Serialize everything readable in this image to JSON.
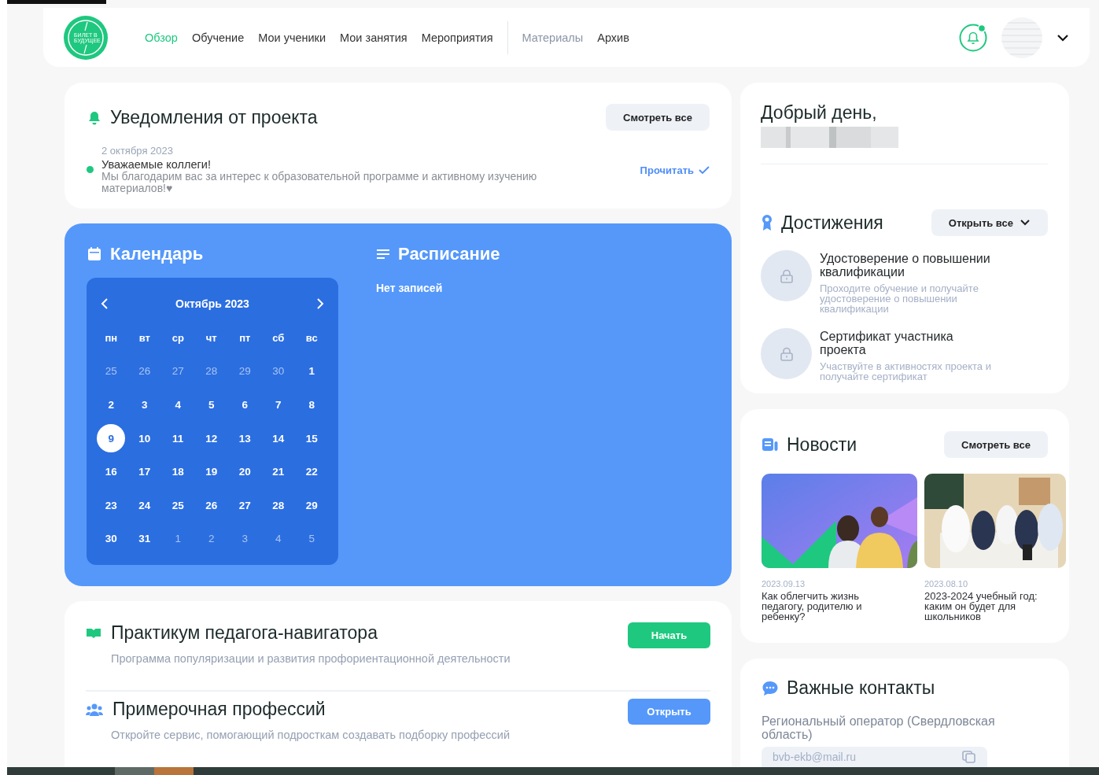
{
  "nav": {
    "logo_text": "БИЛЕТ В БУДУЩЕЕ",
    "item_groups": [
      [
        {
          "label": "Обзор",
          "selected": true,
          "disabled": false
        },
        {
          "label": "Обучение",
          "selected": false,
          "disabled": false
        },
        {
          "label": "Мои ученики",
          "selected": false,
          "disabled": false
        },
        {
          "label": "Мои занятия",
          "selected": false,
          "disabled": false
        },
        {
          "label": "Мероприятия",
          "selected": false,
          "disabled": false
        }
      ],
      [
        {
          "label": "Материалы",
          "selected": false,
          "disabled": true
        },
        {
          "label": "Архив",
          "selected": false,
          "disabled": false
        }
      ]
    ],
    "has_unread": true
  },
  "notifications": {
    "title": "Уведомления от проекта",
    "button": "Смотреть все",
    "items": [
      {
        "date": "2 октября 2023",
        "title": "Уважаемые коллеги!",
        "text": "Мы благодарим вас за интерес к образовательной программе и активному изучению материалов!♥",
        "unread": true,
        "action": "Прочитать"
      }
    ]
  },
  "calendar": {
    "title": "Календарь",
    "month": "Октябрь 2023",
    "weekdays": [
      "пн",
      "вт",
      "ср",
      "чт",
      "пт",
      "сб",
      "вс"
    ],
    "weeks": [
      [
        {
          "day": "25",
          "current_month": false,
          "selected": false
        },
        {
          "day": "26",
          "current_month": false,
          "selected": false
        },
        {
          "day": "27",
          "current_month": false,
          "selected": false
        },
        {
          "day": "28",
          "current_month": false,
          "selected": false
        },
        {
          "day": "29",
          "current_month": false,
          "selected": false
        },
        {
          "day": "30",
          "current_month": false,
          "selected": false
        },
        {
          "day": "1",
          "current_month": true,
          "selected": false
        }
      ],
      [
        {
          "day": "2",
          "current_month": true,
          "selected": false
        },
        {
          "day": "3",
          "current_month": true,
          "selected": false
        },
        {
          "day": "4",
          "current_month": true,
          "selected": false
        },
        {
          "day": "5",
          "current_month": true,
          "selected": false
        },
        {
          "day": "6",
          "current_month": true,
          "selected": false
        },
        {
          "day": "7",
          "current_month": true,
          "selected": false
        },
        {
          "day": "8",
          "current_month": true,
          "selected": false
        }
      ],
      [
        {
          "day": "9",
          "current_month": true,
          "selected": true
        },
        {
          "day": "10",
          "current_month": true,
          "selected": false
        },
        {
          "day": "11",
          "current_month": true,
          "selected": false
        },
        {
          "day": "12",
          "current_month": true,
          "selected": false
        },
        {
          "day": "13",
          "current_month": true,
          "selected": false
        },
        {
          "day": "14",
          "current_month": true,
          "selected": false
        },
        {
          "day": "15",
          "current_month": true,
          "selected": false
        }
      ],
      [
        {
          "day": "16",
          "current_month": true,
          "selected": false
        },
        {
          "day": "17",
          "current_month": true,
          "selected": false
        },
        {
          "day": "18",
          "current_month": true,
          "selected": false
        },
        {
          "day": "19",
          "current_month": true,
          "selected": false
        },
        {
          "day": "20",
          "current_month": true,
          "selected": false
        },
        {
          "day": "21",
          "current_month": true,
          "selected": false
        },
        {
          "day": "22",
          "current_month": true,
          "selected": false
        }
      ],
      [
        {
          "day": "23",
          "current_month": true,
          "selected": false
        },
        {
          "day": "24",
          "current_month": true,
          "selected": false
        },
        {
          "day": "25",
          "current_month": true,
          "selected": false
        },
        {
          "day": "26",
          "current_month": true,
          "selected": false
        },
        {
          "day": "27",
          "current_month": true,
          "selected": false
        },
        {
          "day": "28",
          "current_month": true,
          "selected": false
        },
        {
          "day": "29",
          "current_month": true,
          "selected": false
        }
      ],
      [
        {
          "day": "30",
          "current_month": true,
          "selected": false
        },
        {
          "day": "31",
          "current_month": true,
          "selected": false
        },
        {
          "day": "1",
          "current_month": false,
          "selected": false
        },
        {
          "day": "2",
          "current_month": false,
          "selected": false
        },
        {
          "day": "3",
          "current_month": false,
          "selected": false
        },
        {
          "day": "4",
          "current_month": false,
          "selected": false
        },
        {
          "day": "5",
          "current_month": false,
          "selected": false
        }
      ]
    ]
  },
  "schedule": {
    "title": "Расписание",
    "empty_text": "Нет записей"
  },
  "programs": [
    {
      "kind": "book",
      "title": "Практикум педагога-навигатора",
      "text": "Программа популяризации и развития профориентационной деятельности",
      "button": "Начать"
    },
    {
      "kind": "people",
      "title": "Примерочная профессий",
      "text": "Откройте сервис, помогающий подросткам создавать подборку профессий",
      "button": "Открыть"
    }
  ],
  "greeting": {
    "title": "Добрый день,"
  },
  "achievements": {
    "title": "Достижения",
    "button": "Открыть все",
    "items": [
      {
        "title": "Удостоверение о повышении квалификации",
        "text": "Проходите обучение и получайте удостоверение о повышении квалификации",
        "locked": true
      },
      {
        "title": "Сертификат участника проекта",
        "text": "Участвуйте в активностях проекта и получайте сертификат",
        "locked": true
      }
    ]
  },
  "news": {
    "title": "Новости",
    "button": "Смотреть все",
    "items": [
      {
        "kind": "picture",
        "date": "2023.09.13",
        "title": "Как облегчить жизнь педагогу, родителю и ребенку?"
      },
      {
        "kind": "picture",
        "date": "2023.08.10",
        "title": "2023-2024 учебный год: каким он будет для школьников"
      }
    ]
  },
  "contacts": {
    "title": "Важные контакты",
    "operator": "Региональный оператор (Свердловская область)",
    "email": "bvb-ekb@mail.ru"
  }
}
